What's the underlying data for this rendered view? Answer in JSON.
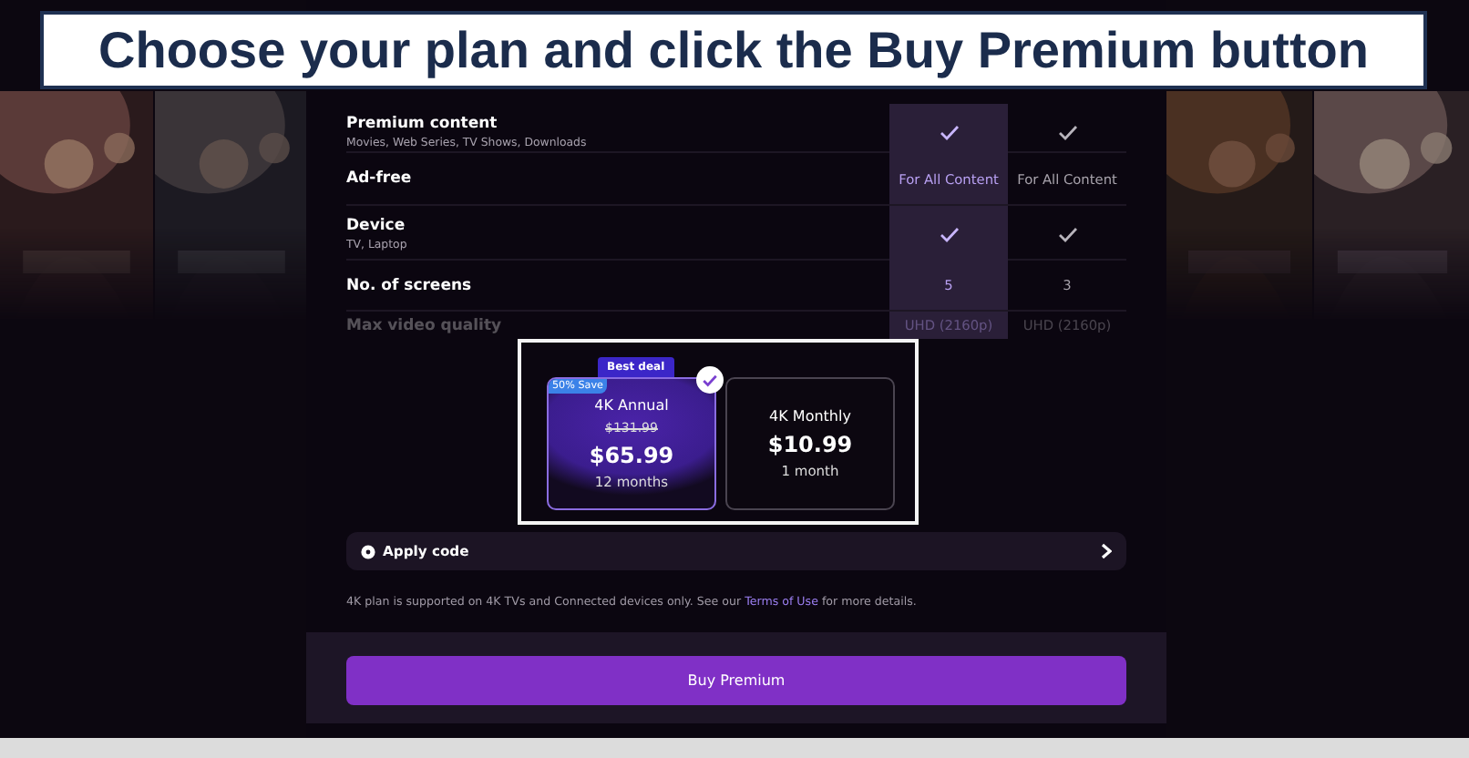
{
  "banner": {
    "text": "Choose your plan and click the Buy Premium button"
  },
  "plan_columns": [
    {
      "selected": true
    },
    {
      "selected": false
    }
  ],
  "features": [
    {
      "label": "Premium content",
      "sublabel": "Movies, Web Series, TV Shows, Downloads",
      "faded": false,
      "values": [
        {
          "kind": "check"
        },
        {
          "kind": "check"
        }
      ]
    },
    {
      "label": "Ad-free",
      "faded": false,
      "values": [
        {
          "kind": "text",
          "text": "For All Content"
        },
        {
          "kind": "text",
          "text": "For All Content"
        }
      ]
    },
    {
      "label": "Device",
      "sublabel": "TV, Laptop",
      "faded": false,
      "values": [
        {
          "kind": "check"
        },
        {
          "kind": "check"
        }
      ]
    },
    {
      "label": "No. of screens",
      "faded": false,
      "values": [
        {
          "kind": "text",
          "text": "5"
        },
        {
          "kind": "text",
          "text": "3"
        }
      ]
    },
    {
      "label": "Max video quality",
      "faded": true,
      "values": [
        {
          "kind": "text",
          "text": "UHD (2160p)"
        },
        {
          "kind": "text",
          "text": "UHD (2160p)"
        }
      ]
    }
  ],
  "plans": [
    {
      "name": "4K Annual",
      "ribbon": "Best deal",
      "badge": "50% Save",
      "original_price": "$131.99",
      "price": "$65.99",
      "period": "12 months",
      "selected": true
    },
    {
      "name": "4K Monthly",
      "price": "$10.99",
      "period": "1 month",
      "selected": false
    }
  ],
  "apply_code": {
    "label": "Apply code"
  },
  "note": {
    "before": "4K plan is supported on 4K TVs and Connected devices only. See our ",
    "link": "Terms of Use",
    "after": " for more details."
  },
  "buy_button": {
    "label": "Buy Premium"
  }
}
